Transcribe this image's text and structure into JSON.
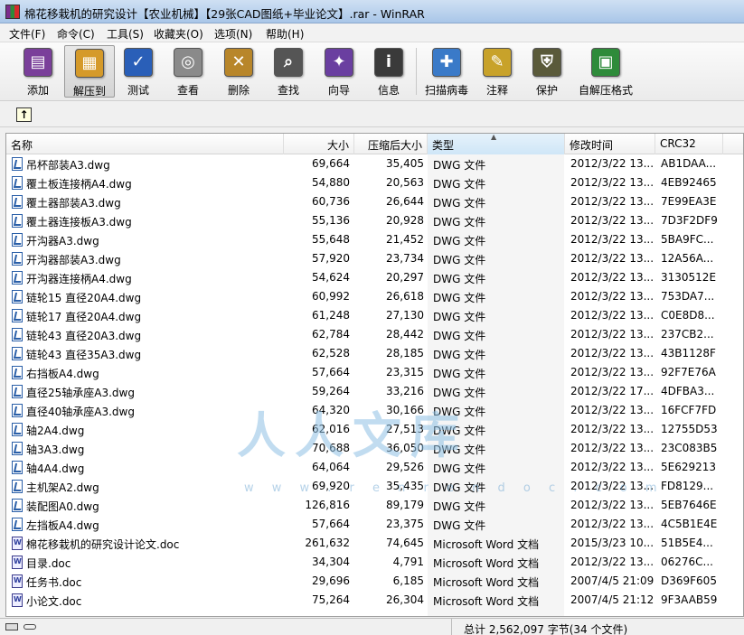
{
  "window": {
    "title": "棉花移栽机的研究设计【农业机械】【29张CAD图纸+毕业论文】.rar - WinRAR"
  },
  "menu": [
    "文件(F)",
    "命令(C)",
    "工具(S)",
    "收藏夹(O)",
    "选项(N)",
    "帮助(H)"
  ],
  "toolbar": [
    {
      "label": "添加",
      "icon": "add-archive-icon",
      "color": "#7a3f9a"
    },
    {
      "label": "解压到",
      "icon": "extract-to-icon",
      "color": "#d59a2a",
      "pressed": true
    },
    {
      "label": "测试",
      "icon": "test-icon",
      "color": "#2a5fb8"
    },
    {
      "label": "查看",
      "icon": "view-icon",
      "color": "#8a8a8a"
    },
    {
      "label": "删除",
      "icon": "delete-icon",
      "color": "#b8862a"
    },
    {
      "label": "查找",
      "icon": "find-icon",
      "color": "#555555"
    },
    {
      "label": "向导",
      "icon": "wizard-icon",
      "color": "#6a3fa0"
    },
    {
      "label": "信息",
      "icon": "info-icon",
      "color": "#3a3a3a"
    },
    {
      "label": "扫描病毒",
      "icon": "virus-scan-icon",
      "color": "#3a7ac8"
    },
    {
      "label": "注释",
      "icon": "comment-icon",
      "color": "#c8a22a"
    },
    {
      "label": "保护",
      "icon": "protect-icon",
      "color": "#5a5a3a"
    },
    {
      "label": "自解压格式",
      "icon": "sfx-icon",
      "color": "#2e8b3a"
    }
  ],
  "columns": {
    "name": "名称",
    "size": "大小",
    "packed": "压缩后大小",
    "type": "类型",
    "modified": "修改时间",
    "crc": "CRC32"
  },
  "files": [
    {
      "name": "吊杯部装A3.dwg",
      "size": "69,664",
      "packed": "35,405",
      "type": "DWG 文件",
      "modified": "2012/3/22 13...",
      "crc": "AB1DAA...",
      "kind": "dwg"
    },
    {
      "name": "覆土板连接柄A4.dwg",
      "size": "54,880",
      "packed": "20,563",
      "type": "DWG 文件",
      "modified": "2012/3/22 13...",
      "crc": "4EB92465",
      "kind": "dwg"
    },
    {
      "name": "覆土器部装A3.dwg",
      "size": "60,736",
      "packed": "26,644",
      "type": "DWG 文件",
      "modified": "2012/3/22 13...",
      "crc": "7E99EA3E",
      "kind": "dwg"
    },
    {
      "name": "覆土器连接板A3.dwg",
      "size": "55,136",
      "packed": "20,928",
      "type": "DWG 文件",
      "modified": "2012/3/22 13...",
      "crc": "7D3F2DF9",
      "kind": "dwg"
    },
    {
      "name": "开沟器A3.dwg",
      "size": "55,648",
      "packed": "21,452",
      "type": "DWG 文件",
      "modified": "2012/3/22 13...",
      "crc": "5BA9FC...",
      "kind": "dwg"
    },
    {
      "name": "开沟器部装A3.dwg",
      "size": "57,920",
      "packed": "23,734",
      "type": "DWG 文件",
      "modified": "2012/3/22 13...",
      "crc": "12A56A...",
      "kind": "dwg"
    },
    {
      "name": "开沟器连接柄A4.dwg",
      "size": "54,624",
      "packed": "20,297",
      "type": "DWG 文件",
      "modified": "2012/3/22 13...",
      "crc": "3130512E",
      "kind": "dwg"
    },
    {
      "name": "链轮15 直径20A4.dwg",
      "size": "60,992",
      "packed": "26,618",
      "type": "DWG 文件",
      "modified": "2012/3/22 13...",
      "crc": "753DA7...",
      "kind": "dwg"
    },
    {
      "name": "链轮17 直径20A4.dwg",
      "size": "61,248",
      "packed": "27,130",
      "type": "DWG 文件",
      "modified": "2012/3/22 13...",
      "crc": "C0E8D8...",
      "kind": "dwg"
    },
    {
      "name": "链轮43 直径20A3.dwg",
      "size": "62,784",
      "packed": "28,442",
      "type": "DWG 文件",
      "modified": "2012/3/22 13...",
      "crc": "237CB2...",
      "kind": "dwg"
    },
    {
      "name": "链轮43 直径35A3.dwg",
      "size": "62,528",
      "packed": "28,185",
      "type": "DWG 文件",
      "modified": "2012/3/22 13...",
      "crc": "43B1128F",
      "kind": "dwg"
    },
    {
      "name": "右挡板A4.dwg",
      "size": "57,664",
      "packed": "23,315",
      "type": "DWG 文件",
      "modified": "2012/3/22 13...",
      "crc": "92F7E76A",
      "kind": "dwg"
    },
    {
      "name": "直径25轴承座A3.dwg",
      "size": "59,264",
      "packed": "33,216",
      "type": "DWG 文件",
      "modified": "2012/3/22 17...",
      "crc": "4DFBA3...",
      "kind": "dwg"
    },
    {
      "name": "直径40轴承座A3.dwg",
      "size": "64,320",
      "packed": "30,166",
      "type": "DWG 文件",
      "modified": "2012/3/22 13...",
      "crc": "16FCF7FD",
      "kind": "dwg"
    },
    {
      "name": "轴2A4.dwg",
      "size": "62,016",
      "packed": "27,513",
      "type": "DWG 文件",
      "modified": "2012/3/22 13...",
      "crc": "12755D53",
      "kind": "dwg"
    },
    {
      "name": "轴3A3.dwg",
      "size": "70,688",
      "packed": "36,050",
      "type": "DWG 文件",
      "modified": "2012/3/22 13...",
      "crc": "23C083B5",
      "kind": "dwg"
    },
    {
      "name": "轴4A4.dwg",
      "size": "64,064",
      "packed": "29,526",
      "type": "DWG 文件",
      "modified": "2012/3/22 13...",
      "crc": "5E629213",
      "kind": "dwg"
    },
    {
      "name": "主机架A2.dwg",
      "size": "69,920",
      "packed": "35,435",
      "type": "DWG 文件",
      "modified": "2012/3/22 13...",
      "crc": "FD8129...",
      "kind": "dwg"
    },
    {
      "name": "装配图A0.dwg",
      "size": "126,816",
      "packed": "89,179",
      "type": "DWG 文件",
      "modified": "2012/3/22 13...",
      "crc": "5EB7646E",
      "kind": "dwg"
    },
    {
      "name": "左挡板A4.dwg",
      "size": "57,664",
      "packed": "23,375",
      "type": "DWG 文件",
      "modified": "2012/3/22 13...",
      "crc": "4C5B1E4E",
      "kind": "dwg"
    },
    {
      "name": "棉花移栽机的研究设计论文.doc",
      "size": "261,632",
      "packed": "74,645",
      "type": "Microsoft Word 文档",
      "modified": "2015/3/23 10...",
      "crc": "51B5E4...",
      "kind": "doc"
    },
    {
      "name": "目录.doc",
      "size": "34,304",
      "packed": "4,791",
      "type": "Microsoft Word 文档",
      "modified": "2012/3/22 13...",
      "crc": "06276C...",
      "kind": "doc"
    },
    {
      "name": "任务书.doc",
      "size": "29,696",
      "packed": "6,185",
      "type": "Microsoft Word 文档",
      "modified": "2007/4/5 21:09",
      "crc": "D369F605",
      "kind": "doc"
    },
    {
      "name": "小论文.doc",
      "size": "75,264",
      "packed": "26,304",
      "type": "Microsoft Word 文档",
      "modified": "2007/4/5 21:12",
      "crc": "9F3AAB59",
      "kind": "doc"
    }
  ],
  "watermark": {
    "text": "人人文库",
    "url": "w w w . r e n r e n d o c . c o m"
  },
  "status": {
    "total": "总计 2,562,097 字节(34 个文件)"
  }
}
